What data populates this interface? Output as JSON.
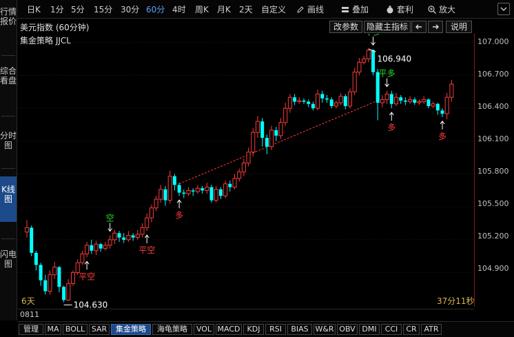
{
  "sidebar": {
    "items": [
      {
        "label": "行情报价"
      },
      {
        "label": "综合看盘"
      },
      {
        "label": "分时图"
      },
      {
        "label": "K线图"
      },
      {
        "label": "闪电图"
      }
    ]
  },
  "toolbar": {
    "periods": [
      "日K",
      "1分",
      "5分",
      "15分",
      "30分",
      "60分",
      "4时",
      "周K",
      "月K",
      "2天",
      "自定义"
    ],
    "active_period": "60分",
    "draw_label": "画线",
    "overlay_label": "叠加",
    "arb_label": "套利",
    "zoom_label": "放大"
  },
  "header": {
    "instrument": "美元指数 (60分钟)",
    "strategy": "集金策略 JJCL",
    "btn_params": "改参数",
    "btn_hide": "隐藏主指标",
    "btn_help": "说明"
  },
  "yaxis": {
    "labels": [
      "107.000",
      "106.700",
      "106.400",
      "106.100",
      "105.800",
      "105.500",
      "105.200",
      "104.900"
    ]
  },
  "status": {
    "left": "6天",
    "right": "37分11秒",
    "code": "0811"
  },
  "chart_data": {
    "type": "candlestick",
    "ylim": [
      104.57,
      107.08
    ],
    "candles": [
      [
        105.27,
        105.31,
        105.38,
        105.22
      ],
      [
        105.31,
        105.08,
        105.33,
        105.05
      ],
      [
        105.08,
        104.97,
        105.1,
        104.92
      ],
      [
        104.97,
        104.83,
        104.99,
        104.78
      ],
      [
        104.83,
        104.73,
        104.88,
        104.7
      ],
      [
        104.73,
        104.88,
        104.92,
        104.7
      ],
      [
        104.88,
        104.95,
        105.0,
        104.84
      ],
      [
        104.95,
        104.77,
        104.96,
        104.72
      ],
      [
        104.77,
        104.65,
        104.78,
        104.63
      ],
      [
        104.65,
        104.8,
        104.84,
        104.64
      ],
      [
        104.8,
        104.9,
        104.92,
        104.78
      ],
      [
        104.9,
        104.99,
        105.02,
        104.88
      ],
      [
        104.99,
        105.07,
        105.1,
        104.97
      ],
      [
        105.07,
        105.15,
        105.18,
        105.04
      ],
      [
        105.15,
        105.1,
        105.2,
        105.07
      ],
      [
        105.1,
        105.16,
        105.19,
        105.06
      ],
      [
        105.16,
        105.12,
        105.17,
        105.09
      ],
      [
        105.12,
        105.15,
        105.18,
        105.1
      ],
      [
        105.15,
        105.2,
        105.24,
        105.12
      ],
      [
        105.2,
        105.26,
        105.29,
        105.16
      ],
      [
        105.26,
        105.22,
        105.28,
        105.18
      ],
      [
        105.22,
        105.2,
        105.26,
        105.17
      ],
      [
        105.2,
        105.24,
        105.28,
        105.18
      ],
      [
        105.24,
        105.22,
        105.26,
        105.19
      ],
      [
        105.22,
        105.25,
        105.29,
        105.2
      ],
      [
        105.25,
        105.31,
        105.35,
        105.22
      ],
      [
        105.31,
        105.4,
        105.44,
        105.28
      ],
      [
        105.4,
        105.49,
        105.52,
        105.36
      ],
      [
        105.49,
        105.57,
        105.6,
        105.46
      ],
      [
        105.57,
        105.66,
        105.7,
        105.54
      ],
      [
        105.66,
        105.56,
        105.69,
        105.51
      ],
      [
        105.56,
        105.78,
        105.83,
        105.53
      ],
      [
        105.78,
        105.7,
        105.8,
        105.65
      ],
      [
        105.7,
        105.63,
        105.72,
        105.6
      ],
      [
        105.63,
        105.62,
        105.66,
        105.58
      ],
      [
        105.62,
        105.65,
        105.68,
        105.6
      ],
      [
        105.65,
        105.64,
        105.67,
        105.6
      ],
      [
        105.64,
        105.67,
        105.7,
        105.62
      ],
      [
        105.67,
        105.65,
        105.69,
        105.62
      ],
      [
        105.65,
        105.68,
        105.72,
        105.62
      ],
      [
        105.68,
        105.56,
        105.7,
        105.54
      ],
      [
        105.56,
        105.66,
        105.69,
        105.54
      ],
      [
        105.66,
        105.6,
        105.68,
        105.57
      ],
      [
        105.6,
        105.71,
        105.74,
        105.58
      ],
      [
        105.71,
        105.68,
        105.74,
        105.64
      ],
      [
        105.68,
        105.76,
        105.8,
        105.66
      ],
      [
        105.76,
        105.82,
        105.85,
        105.73
      ],
      [
        105.82,
        105.9,
        105.94,
        105.78
      ],
      [
        105.9,
        106.0,
        106.04,
        105.87
      ],
      [
        106.0,
        106.18,
        106.22,
        105.96
      ],
      [
        106.18,
        106.28,
        106.33,
        106.13
      ],
      [
        106.28,
        106.13,
        106.31,
        106.05
      ],
      [
        106.13,
        106.05,
        106.16,
        105.98
      ],
      [
        106.05,
        106.2,
        106.24,
        106.02
      ],
      [
        106.2,
        106.15,
        106.23,
        106.1
      ],
      [
        106.15,
        106.27,
        106.31,
        106.12
      ],
      [
        106.27,
        106.4,
        106.45,
        106.24
      ],
      [
        106.4,
        106.5,
        106.53,
        106.36
      ],
      [
        106.5,
        106.46,
        106.53,
        106.43
      ],
      [
        106.46,
        106.47,
        106.5,
        106.44
      ],
      [
        106.47,
        106.46,
        106.49,
        106.44
      ],
      [
        106.46,
        106.44,
        106.48,
        106.41
      ],
      [
        106.44,
        106.4,
        106.46,
        106.38
      ],
      [
        106.4,
        106.53,
        106.57,
        106.38
      ],
      [
        106.53,
        106.49,
        106.56,
        106.45
      ],
      [
        106.49,
        106.48,
        106.52,
        106.45
      ],
      [
        106.48,
        106.42,
        106.5,
        106.4
      ],
      [
        106.42,
        106.45,
        106.47,
        106.4
      ],
      [
        106.45,
        106.51,
        106.54,
        106.43
      ],
      [
        106.51,
        106.42,
        106.53,
        106.39
      ],
      [
        106.42,
        106.55,
        106.58,
        106.4
      ],
      [
        106.55,
        106.73,
        106.77,
        106.52
      ],
      [
        106.73,
        106.82,
        106.86,
        106.7
      ],
      [
        106.82,
        106.85,
        106.88,
        106.8
      ],
      [
        106.85,
        106.93,
        106.95,
        106.82
      ],
      [
        106.93,
        106.73,
        106.94,
        106.7
      ],
      [
        106.73,
        106.45,
        106.76,
        106.29
      ],
      [
        106.45,
        106.48,
        106.52,
        106.41
      ],
      [
        106.48,
        106.53,
        106.56,
        106.44
      ],
      [
        106.53,
        106.44,
        106.56,
        106.4
      ],
      [
        106.44,
        106.5,
        106.54,
        106.42
      ],
      [
        106.5,
        106.47,
        106.52,
        106.44
      ],
      [
        106.47,
        106.46,
        106.5,
        106.43
      ],
      [
        106.46,
        106.48,
        106.51,
        106.44
      ],
      [
        106.48,
        106.45,
        106.5,
        106.43
      ],
      [
        106.45,
        106.46,
        106.48,
        106.43
      ],
      [
        106.46,
        106.48,
        106.51,
        106.44
      ],
      [
        106.48,
        106.42,
        106.49,
        106.4
      ],
      [
        106.42,
        106.44,
        106.46,
        106.4
      ],
      [
        106.44,
        106.38,
        106.45,
        106.34
      ],
      [
        106.38,
        106.35,
        106.4,
        106.32
      ],
      [
        106.35,
        106.5,
        106.54,
        106.3
      ],
      [
        106.5,
        106.62,
        106.66,
        106.46
      ]
    ],
    "high_label": {
      "index": 75,
      "text": "106.940"
    },
    "low_label": {
      "index": 8,
      "text": "104.630"
    },
    "signals": [
      {
        "index": 13,
        "text": "平空",
        "dir": "up",
        "color": "red"
      },
      {
        "index": 18,
        "text": "空",
        "dir": "down",
        "color": "green"
      },
      {
        "index": 26,
        "text": "平空",
        "dir": "up",
        "color": "red"
      },
      {
        "index": 33,
        "text": "多",
        "dir": "up",
        "color": "red"
      },
      {
        "index": 75,
        "text": "平多",
        "dir": "down",
        "color": "green"
      },
      {
        "index": 78,
        "text": "平多",
        "dir": "down",
        "color": "green"
      },
      {
        "index": 79,
        "text": "多",
        "dir": "up",
        "color": "red"
      },
      {
        "index": 90,
        "text": "多",
        "dir": "up",
        "color": "red"
      }
    ],
    "trend": {
      "from": [
        33,
        105.71
      ],
      "to": [
        76,
        106.47
      ]
    },
    "colors": {
      "up": "#ff3b3b",
      "down": "#00ffff",
      "flat": "#ffffff",
      "grid": "#4a0f0f",
      "axis": "#8a1a1a"
    }
  },
  "bottom": {
    "tabs": [
      "管理",
      "MA",
      "BOLL",
      "SAR",
      "集金策略",
      "海龟策略",
      "VOL",
      "MACD",
      "KDJ",
      "RSI",
      "BIAS",
      "W&R",
      "OBV",
      "DMI",
      "CCI",
      "CR",
      "ATR"
    ],
    "active": "集金策略"
  }
}
